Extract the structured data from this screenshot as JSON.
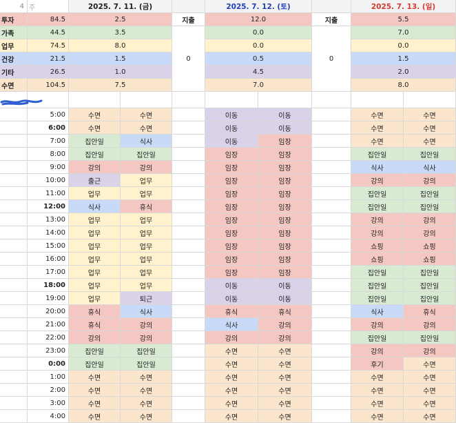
{
  "week_label": "4",
  "week_unit": "주",
  "days": [
    {
      "date": "2025. 7. 11. (금)",
      "color": "#222222"
    },
    {
      "date": "2025. 7. 12. (토)",
      "color": "#1f3fbf"
    },
    {
      "date": "2025. 7. 13. (일)",
      "color": "#d43a2f"
    }
  ],
  "expense_label": "지출",
  "expenses": [
    "0",
    "0"
  ],
  "categories": [
    {
      "name": "투자",
      "total": "84.5",
      "color": "#f4c7c3",
      "values": [
        "2.5",
        "12.0",
        "5.5"
      ]
    },
    {
      "name": "가족",
      "total": "44.5",
      "color": "#d9ead3",
      "values": [
        "3.5",
        "0.0",
        "7.0"
      ]
    },
    {
      "name": "업무",
      "total": "74.5",
      "color": "#fff2cc",
      "values": [
        "8.0",
        "0.0",
        "0.0"
      ]
    },
    {
      "name": "건강",
      "total": "21.5",
      "color": "#c9daf8",
      "values": [
        "1.5",
        "0.5",
        "1.5"
      ]
    },
    {
      "name": "기타",
      "total": "26.5",
      "color": "#d9d2e9",
      "values": [
        "1.0",
        "4.5",
        "2.0"
      ]
    },
    {
      "name": "수면",
      "total": "104.5",
      "color": "#fce5cd",
      "values": [
        "7.5",
        "7.0",
        "8.0"
      ]
    }
  ],
  "activity_colors": {
    "수면": "#fce5cd",
    "식사": "#c9daf8",
    "집안일": "#d9ead3",
    "강의": "#f4c7c3",
    "출근": "#d9d2e9",
    "업무": "#fff2cc",
    "휴식": "#f4c7c3",
    "퇴근": "#d9d2e9",
    "이동": "#d9d2e9",
    "임장": "#f4c7c3",
    "쇼핑": "#f4c7c3",
    "후기": "#f4c7c3"
  },
  "schedule": [
    {
      "time": "5:00",
      "bold": false,
      "cells": [
        "수면",
        "수면",
        "이동",
        "이동",
        "수면",
        "수면"
      ]
    },
    {
      "time": "6:00",
      "bold": true,
      "cells": [
        "수면",
        "수면",
        "이동",
        "이동",
        "수면",
        "수면"
      ]
    },
    {
      "time": "7:00",
      "bold": false,
      "cells": [
        "집안일",
        "식사",
        "이동",
        "임장",
        "수면",
        "수면"
      ]
    },
    {
      "time": "8:00",
      "bold": false,
      "cells": [
        "집안일",
        "집안일",
        "임장",
        "임장",
        "집안일",
        "집안일"
      ]
    },
    {
      "time": "9:00",
      "bold": false,
      "cells": [
        "강의",
        "강의",
        "임장",
        "임장",
        "식사",
        "식사"
      ]
    },
    {
      "time": "10:00",
      "bold": false,
      "cells": [
        "출근",
        "업무",
        "임장",
        "임장",
        "강의",
        "강의"
      ]
    },
    {
      "time": "11:00",
      "bold": false,
      "cells": [
        "업무",
        "업무",
        "임장",
        "임장",
        "집안일",
        "집안일"
      ]
    },
    {
      "time": "12:00",
      "bold": true,
      "cells": [
        "식사",
        "휴식",
        "임장",
        "임장",
        "집안일",
        "집안일"
      ]
    },
    {
      "time": "13:00",
      "bold": false,
      "cells": [
        "업무",
        "업무",
        "임장",
        "임장",
        "강의",
        "강의"
      ]
    },
    {
      "time": "14:00",
      "bold": false,
      "cells": [
        "업무",
        "업무",
        "임장",
        "임장",
        "강의",
        "강의"
      ]
    },
    {
      "time": "15:00",
      "bold": false,
      "cells": [
        "업무",
        "업무",
        "임장",
        "임장",
        "쇼핑",
        "쇼핑"
      ]
    },
    {
      "time": "16:00",
      "bold": false,
      "cells": [
        "업무",
        "업무",
        "임장",
        "임장",
        "쇼핑",
        "쇼핑"
      ]
    },
    {
      "time": "17:00",
      "bold": false,
      "cells": [
        "업무",
        "업무",
        "임장",
        "임장",
        "집안일",
        "집안일"
      ]
    },
    {
      "time": "18:00",
      "bold": true,
      "cells": [
        "업무",
        "업무",
        "이동",
        "이동",
        "집안일",
        "집안일"
      ]
    },
    {
      "time": "19:00",
      "bold": false,
      "cells": [
        "업무",
        "퇴근",
        "이동",
        "이동",
        "집안일",
        "집안일"
      ]
    },
    {
      "time": "20:00",
      "bold": false,
      "cells": [
        "휴식",
        "식사",
        "휴식",
        "휴식",
        "식사",
        "휴식"
      ]
    },
    {
      "time": "21:00",
      "bold": false,
      "cells": [
        "휴식",
        "강의",
        "식사",
        "강의",
        "강의",
        "강의"
      ]
    },
    {
      "time": "22:00",
      "bold": false,
      "cells": [
        "강의",
        "강의",
        "강의",
        "강의",
        "집안일",
        "집안일"
      ]
    },
    {
      "time": "23:00",
      "bold": false,
      "cells": [
        "집안일",
        "집안일",
        "수면",
        "수면",
        "강의",
        "강의"
      ]
    },
    {
      "time": "0:00",
      "bold": true,
      "cells": [
        "집안일",
        "집안일",
        "수면",
        "수면",
        "후기",
        "수면"
      ]
    },
    {
      "time": "1:00",
      "bold": false,
      "cells": [
        "수면",
        "수면",
        "수면",
        "수면",
        "수면",
        "수면"
      ]
    },
    {
      "time": "2:00",
      "bold": false,
      "cells": [
        "수면",
        "수면",
        "수면",
        "수면",
        "수면",
        "수면"
      ]
    },
    {
      "time": "3:00",
      "bold": false,
      "cells": [
        "수면",
        "수면",
        "수면",
        "수면",
        "수면",
        "수면"
      ]
    },
    {
      "time": "4:00",
      "bold": false,
      "cells": [
        "수면",
        "수면",
        "수면",
        "수면",
        "수면",
        "수면"
      ]
    }
  ]
}
